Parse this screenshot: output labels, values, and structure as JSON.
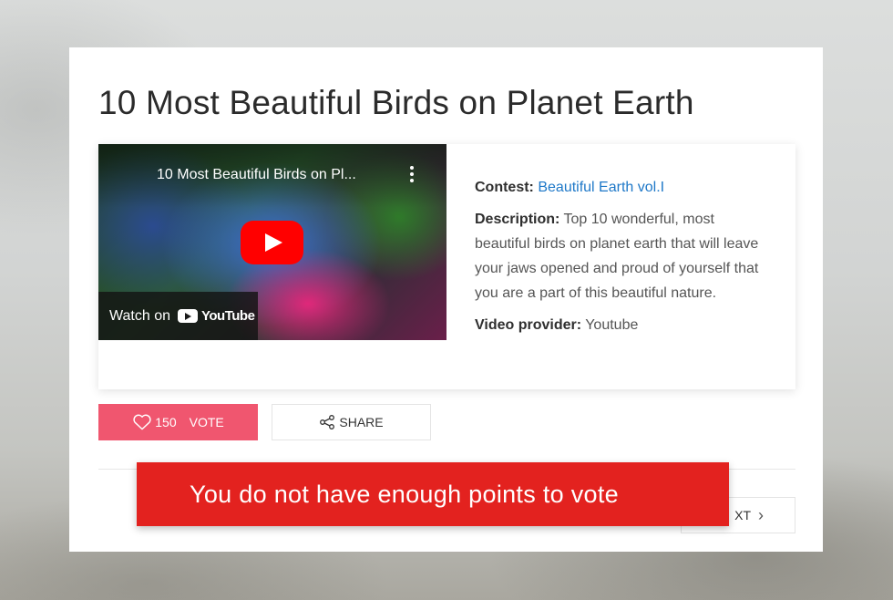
{
  "entry": {
    "title": "10 Most Beautiful Birds on Planet Earth",
    "video": {
      "overlay_title": "10 Most Beautiful Birds on Pl...",
      "watch_on": "Watch on",
      "platform_logo": "YouTube",
      "icons": [
        "play-button-icon",
        "kebab-menu-icon",
        "youtube-logo-icon"
      ]
    },
    "contest_label": "Contest:",
    "contest_value": "Beautiful Earth vol.I",
    "description_label": "Description:",
    "description_value": "Top 10 wonderful, most beautiful birds on planet earth that will leave your jaws opened and proud of yourself that you are a part of this beautiful nature.",
    "provider_label": "Video provider:",
    "provider_value": "Youtube"
  },
  "actions": {
    "vote_count": "150",
    "vote_label": "VOTE",
    "share_label": "SHARE",
    "next_label": "XT"
  },
  "toast": {
    "message": "You do not have enough points to vote"
  },
  "colors": {
    "vote_button": "#f0566f",
    "toast_background": "#e3221f",
    "link": "#1e78c8",
    "youtube_red": "#ff0000"
  }
}
